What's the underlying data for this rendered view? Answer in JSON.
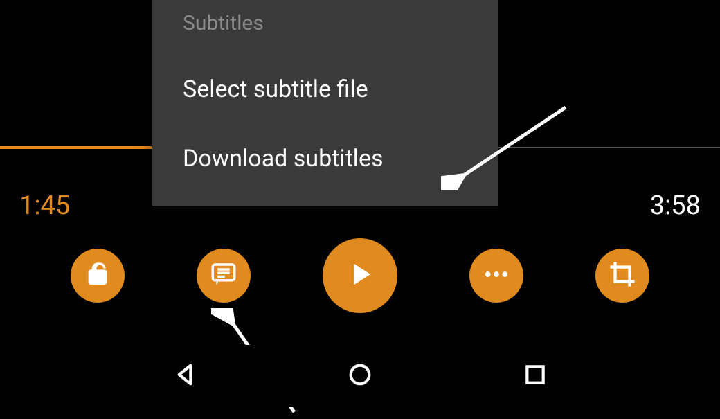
{
  "popup": {
    "header": "Subtitles",
    "items": [
      {
        "label": "Select subtitle file"
      },
      {
        "label": "Download subtitles"
      }
    ]
  },
  "playback": {
    "current_time": "1:45",
    "total_time": "3:58",
    "progress_pct": 44
  },
  "controls": {
    "lock": "lock-button",
    "subtitles": "subtitles-button",
    "play": "play-button",
    "more": "more-options-button",
    "crop": "crop-button"
  },
  "nav": {
    "back": "back",
    "home": "home",
    "recent": "recent"
  },
  "colors": {
    "accent": "#e08a1f",
    "popup_bg": "#3a3a3a"
  }
}
